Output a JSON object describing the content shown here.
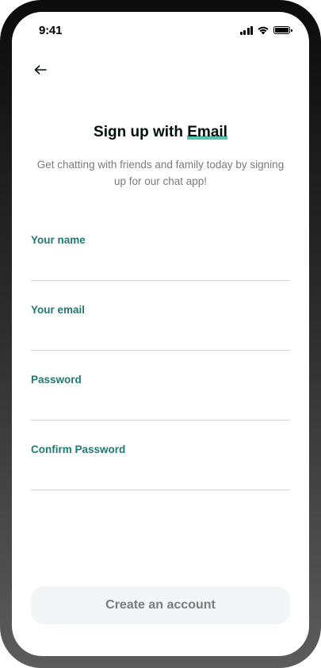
{
  "status_bar": {
    "time": "9:41",
    "icons": [
      "cellular-signal-icon",
      "wifi-icon",
      "battery-icon"
    ]
  },
  "header": {
    "back_icon": "arrow-left-icon",
    "title_prefix": "Sign up with ",
    "title_accent": "Email",
    "subtitle": "Get chatting with friends and family today by signing up for our chat app!"
  },
  "form": {
    "fields": [
      {
        "label": "Your name",
        "value": "",
        "type": "text"
      },
      {
        "label": "Your email",
        "value": "",
        "type": "email"
      },
      {
        "label": "Password",
        "value": "",
        "type": "password"
      },
      {
        "label": "Confirm Password",
        "value": "",
        "type": "password"
      }
    ],
    "submit_label": "Create an account"
  },
  "colors": {
    "accent": "#24786d",
    "highlight": "#58c3b1",
    "muted_text": "#797c7b",
    "button_bg": "#f3f6f6",
    "divider": "#cdd1d0"
  }
}
